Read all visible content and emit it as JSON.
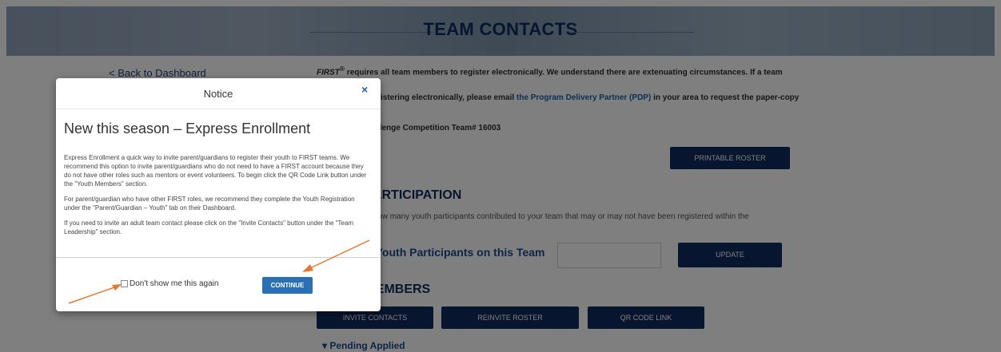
{
  "hero": {
    "title": "TEAM CONTACTS"
  },
  "nav": {
    "back_link": "< Back to Dashboard"
  },
  "intro": {
    "first": "FIRST",
    "reg": "®",
    "text_part1": " requires all team members to register electronically. We understand there are extenuating circumstances. If a team member",
    "text_part2": "has difficulty registering electronically, please email ",
    "link": "the Program Delivery Partner (PDP)",
    "text_part3": " in your area to request the paper-copy Consent"
  },
  "team": {
    "line": "FIRST Tech Challenge Competition Team# 16003"
  },
  "buttons": {
    "printable_roster": "PRINTABLE ROSTER",
    "update": "UPDATE",
    "invite_contacts": "INVITE CONTACTS",
    "reinvite_roster": "REINVITE ROSTER",
    "qr_code_link": "QR CODE LINK"
  },
  "participation": {
    "heading": "YOUTH PARTICIPATION",
    "description": "Please indicate how many youth participants contributed to your team that may or may not have been registered within the",
    "count_label": "Number of Youth Participants on this Team",
    "count_value": ""
  },
  "members": {
    "heading": "YOUTH MEMBERS",
    "pending": "▾ Pending Applied"
  },
  "modal": {
    "title": "Notice",
    "close": "×",
    "heading": "New this season – Express Enrollment",
    "p1": "Express Enrollment a quick way to invite parent/guardians to register their youth to FIRST teams. We recommend this option to invite parent/guardians who do not need to have a FIRST account because they do not have other roles such as mentors or event volunteers. To begin click the QR Code Link button under the \"Youth Members\" section.",
    "p2": "For parent/guardian who have other FIRST roles, we recommend they complete the Youth Registration under the \"Parent/Guardian – Youth\" tab on their Dashboard.",
    "p3": "If you need to invite an adult team contact please click on the \"Invite Contacts\" button under the \"Team Leadership\" section.",
    "checkbox_label": "Don't show me this again",
    "continue_label": "CONTINUE"
  },
  "colors": {
    "navy": "#0e2a5c",
    "accent": "#2b6fb5",
    "arrow": "#e8772e"
  }
}
